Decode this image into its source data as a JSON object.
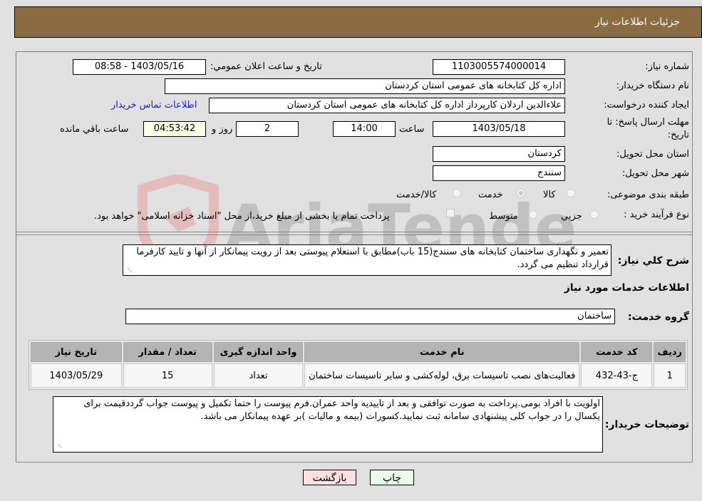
{
  "header": {
    "title": "جزئیات اطلاعات نیاز"
  },
  "fields": {
    "need_number": {
      "label": "شماره نیاز:",
      "value": "1103005574000014"
    },
    "announce_datetime": {
      "label": "تاریخ و ساعت اعلان عمومي:",
      "value": "1403/05/16 - 08:58"
    },
    "buyer_org": {
      "label": "نام دستگاه خريدار:",
      "value": "اداره کل کتابخانه های عمومی استان کردستان"
    },
    "requester": {
      "label": "ایجاد کننده درخواست:",
      "value": "علاءالدین اردلان کارپرداز اداره کل کتابخانه های عمومی استان کردستان"
    },
    "buyer_contact_link": "اطلاعات تماس خریدار",
    "deadline": {
      "label_line1": "مهلت ارسال پاسخ: تا",
      "label_line2": "تاریخ:",
      "date": "1403/05/18",
      "time_label": "ساعت",
      "time": "14:00",
      "days": "2",
      "days_label": "روز و",
      "remaining": "04:53:42",
      "remaining_label": "ساعت باقي مانده"
    },
    "delivery_province": {
      "label": "استان محل تحویل:",
      "value": "کردستان"
    },
    "delivery_city": {
      "label": "شهر محل تحویل:",
      "value": "سنندج"
    },
    "category": {
      "label": "طبقه بندی موضوعی:",
      "options": [
        "کالا",
        "خدمت",
        "کالا/خدمت"
      ],
      "selected": "خدمت"
    },
    "purchase_type": {
      "label": "نوع فرآیند خرید :",
      "options": [
        "جزيي",
        "متوسط"
      ],
      "selected": "",
      "treasury_note": "پرداخت تمام یا بخشی از مبلغ خرید،از محل \"اسناد خزانه اسلامی\" خواهد بود."
    }
  },
  "description": {
    "label": "شرح کلي نياز:",
    "value": "تعمیر و نگهداری ساختمان کتابخانه های سنندج(15 باب)مطابق با استعلام پیوستی بعد از رویت پیمانکار از آنها و تایید کارفرما قرارداد تنظیم می گردد."
  },
  "services_section": {
    "title": "اطلاعات خدمات مورد نياز",
    "group_label": "گروه خدمت:",
    "group_value": "ساختمان"
  },
  "table": {
    "headers": [
      "رديف",
      "کد خدمت",
      "نام خدمت",
      "واحد اندازه گيری",
      "تعداد / مقدار",
      "تاريخ نياز"
    ],
    "rows": [
      [
        "1",
        "ج-43-432",
        "فعالیت‌های نصب تاسیسات برق، لوله‌کشی و سایر تاسیسات ساختمان",
        "تعداد",
        "15",
        "1403/05/29"
      ]
    ]
  },
  "buyer_notes": {
    "label": "توضیحات خریدار:",
    "value": "اولویت با افراد بومی.پرداخت به صورت توافقی و بعد از تاییدیه واحد عمران.فرم پیوست را حتما تکمیل و پیوست جواب گرددقیمت برای یکسال را در جواب کلی پیشنهادی سامانه ثبت نمایید.کسورات (بیمه و مالیات )بر عهده پیمانکار می باشد."
  },
  "buttons": {
    "print": "چاپ",
    "back": "بازگشت"
  },
  "watermark": {
    "text": "AriaTender.neT"
  },
  "colors": {
    "header_bg": "#8b6c42",
    "link": "#1a1ae6",
    "back_btn_bg": "#ffe0e0",
    "print_btn_bg": "#eaffea",
    "remaining_bg": "#ffffe6"
  }
}
